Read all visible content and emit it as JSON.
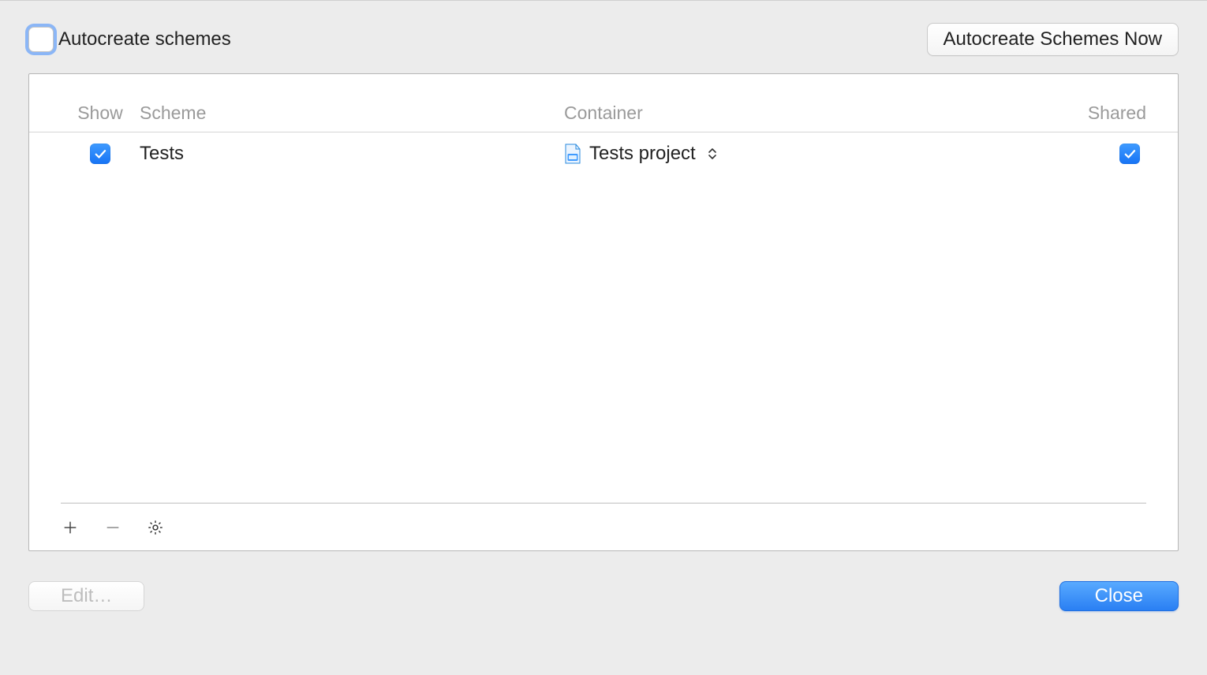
{
  "top": {
    "autocreate_label": "Autocreate schemes",
    "autocreate_checked": false,
    "autocreate_now_button": "Autocreate Schemes Now"
  },
  "table": {
    "headers": {
      "show": "Show",
      "scheme": "Scheme",
      "container": "Container",
      "shared": "Shared"
    },
    "rows": [
      {
        "show": true,
        "scheme": "Tests",
        "container": "Tests project",
        "shared": true
      }
    ]
  },
  "footer": {
    "add_icon": "plus-icon",
    "remove_icon": "minus-icon",
    "settings_icon": "gear-icon"
  },
  "bottom": {
    "edit_button": "Edit…",
    "close_button": "Close"
  }
}
